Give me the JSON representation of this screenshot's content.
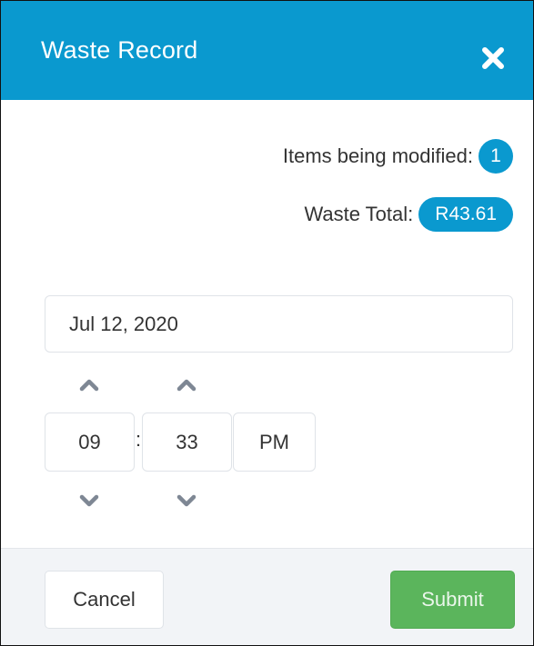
{
  "dialog": {
    "title": "Waste Record",
    "close_icon": "close-icon",
    "colors": {
      "header": "#0a99cf",
      "submit": "#5bb55c"
    }
  },
  "summary": {
    "items_label": "Items being modified:",
    "items_count": "1",
    "total_label": "Waste Total:",
    "total_value": "R43.61"
  },
  "date": {
    "value": "Jul 12, 2020"
  },
  "time": {
    "hour": "09",
    "separator": ":",
    "minute": "33",
    "period": "PM",
    "increment_icon": "chevron-up-icon",
    "decrement_icon": "chevron-down-icon"
  },
  "footer": {
    "cancel_label": "Cancel",
    "submit_label": "Submit"
  }
}
